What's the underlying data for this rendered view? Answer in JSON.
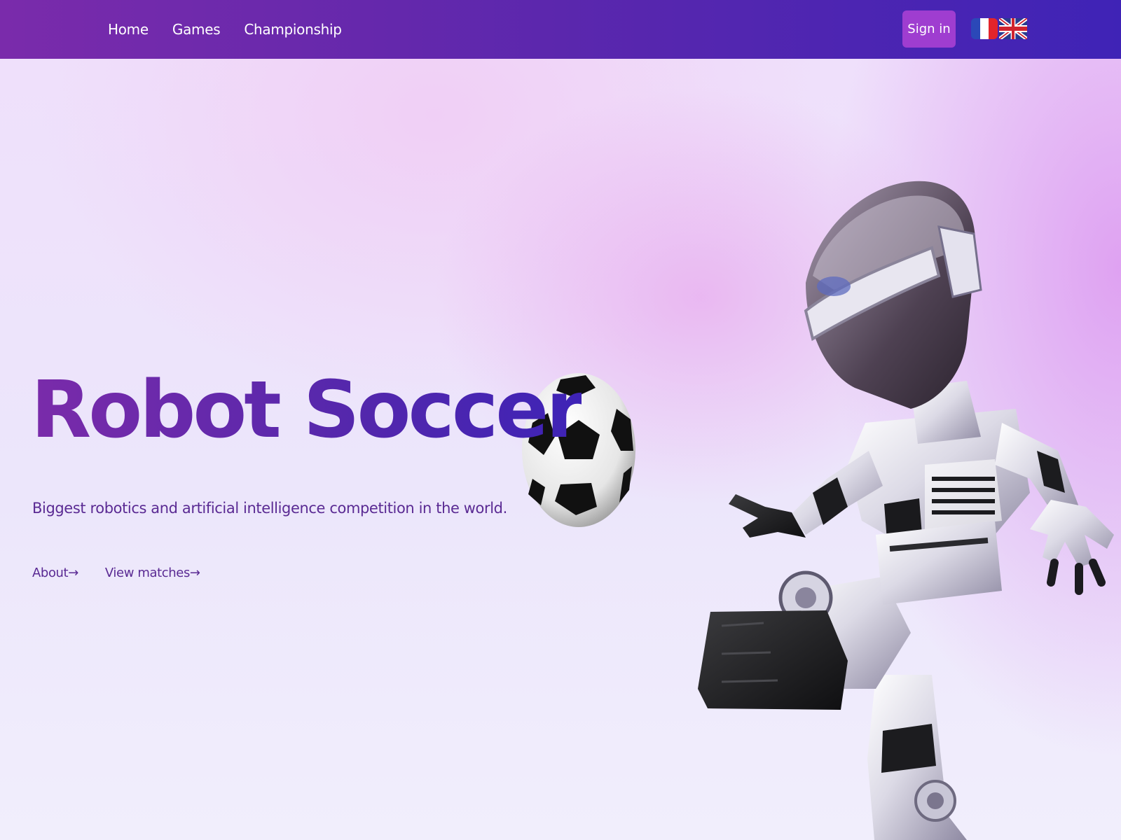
{
  "nav": {
    "items": [
      {
        "label": "Home"
      },
      {
        "label": "Games"
      },
      {
        "label": "Championship"
      }
    ],
    "signin_label": "Sign in",
    "languages": [
      {
        "code": "fr",
        "icon": "france-flag-icon"
      },
      {
        "code": "en",
        "icon": "uk-flag-icon"
      }
    ]
  },
  "hero": {
    "title": "Robot Soccer",
    "subtitle": "Biggest robotics and artificial intelligence competition in the world.",
    "links": [
      {
        "label": "About→"
      },
      {
        "label": "View matches→"
      }
    ],
    "illustration": "robot-kicking-soccer-ball"
  },
  "colors": {
    "nav_start": "#7a2bab",
    "nav_end": "#3f23b6",
    "signin_bg": "#9f3dd0",
    "text_purple": "#5a2a93"
  }
}
